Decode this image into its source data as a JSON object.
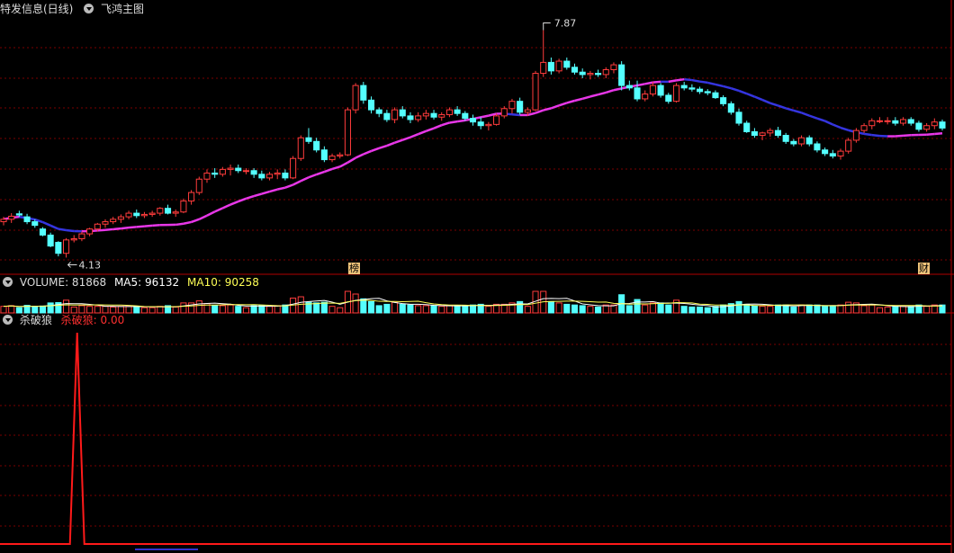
{
  "main_header": {
    "title": "特发信息(日线)",
    "indicator": "飞鸿主图"
  },
  "volume_header": {
    "volume": "VOLUME: 81868",
    "ma5": "MA5: 96132",
    "ma10": "MA10: 90258"
  },
  "osc_header": {
    "name": "杀破狼",
    "value": "杀破狼: 0.00"
  },
  "markers": {
    "high_label": "7.87",
    "low_label": "4.13",
    "tag_list": "榜",
    "tag_fin": "财"
  },
  "colors": {
    "up": "#ff3c3c",
    "down": "#54ffff",
    "ma_magenta": "#e837e8",
    "ma_blue": "#3535e0",
    "osc_line": "#ff1a1a",
    "grid": "#7a0000",
    "ma5_text": "#ffffff",
    "ma10_text": "#ffff55"
  },
  "chart_data": [
    {
      "type": "candlestick",
      "title": "特发信息(日线)",
      "y_range": [
        3.9,
        8.1
      ],
      "series": [
        {
          "name": "飞鸿主图",
          "values": []
        }
      ],
      "candles": [
        [
          4.72,
          4.8,
          4.66,
          4.76
        ],
        [
          4.76,
          4.86,
          4.7,
          4.81
        ],
        [
          4.85,
          4.9,
          4.8,
          4.83
        ],
        [
          4.8,
          4.85,
          4.68,
          4.72
        ],
        [
          4.72,
          4.76,
          4.62,
          4.66
        ],
        [
          4.6,
          4.63,
          4.48,
          4.5
        ],
        [
          4.5,
          4.54,
          4.3,
          4.32
        ],
        [
          4.38,
          4.4,
          4.15,
          4.2
        ],
        [
          4.2,
          4.45,
          4.13,
          4.42
        ],
        [
          4.42,
          4.5,
          4.38,
          4.44
        ],
        [
          4.44,
          4.56,
          4.4,
          4.52
        ],
        [
          4.52,
          4.62,
          4.48,
          4.6
        ],
        [
          4.6,
          4.7,
          4.56,
          4.68
        ],
        [
          4.68,
          4.76,
          4.62,
          4.72
        ],
        [
          4.72,
          4.8,
          4.68,
          4.76
        ],
        [
          4.76,
          4.84,
          4.7,
          4.8
        ],
        [
          4.8,
          4.9,
          4.76,
          4.86
        ],
        [
          4.86,
          4.92,
          4.78,
          4.82
        ],
        [
          4.82,
          4.88,
          4.78,
          4.84
        ],
        [
          4.84,
          4.9,
          4.8,
          4.86
        ],
        [
          4.86,
          4.96,
          4.82,
          4.94
        ],
        [
          4.94,
          5.0,
          4.84,
          4.86
        ],
        [
          4.86,
          4.92,
          4.8,
          4.88
        ],
        [
          4.88,
          5.1,
          4.86,
          5.06
        ],
        [
          5.06,
          5.24,
          5.0,
          5.2
        ],
        [
          5.2,
          5.46,
          5.16,
          5.42
        ],
        [
          5.42,
          5.58,
          5.36,
          5.52
        ],
        [
          5.52,
          5.6,
          5.44,
          5.5
        ],
        [
          5.5,
          5.62,
          5.46,
          5.58
        ],
        [
          5.58,
          5.66,
          5.48,
          5.6
        ],
        [
          5.6,
          5.66,
          5.52,
          5.56
        ],
        [
          5.56,
          5.6,
          5.5,
          5.56
        ],
        [
          5.56,
          5.6,
          5.44,
          5.5
        ],
        [
          5.5,
          5.56,
          5.4,
          5.44
        ],
        [
          5.44,
          5.54,
          5.4,
          5.5
        ],
        [
          5.5,
          5.58,
          5.42,
          5.52
        ],
        [
          5.52,
          5.58,
          5.4,
          5.44
        ],
        [
          5.44,
          5.8,
          5.42,
          5.76
        ],
        [
          5.76,
          6.14,
          5.72,
          6.1
        ],
        [
          6.1,
          6.26,
          6.0,
          6.04
        ],
        [
          6.04,
          6.1,
          5.86,
          5.9
        ],
        [
          5.9,
          5.96,
          5.7,
          5.74
        ],
        [
          5.74,
          5.84,
          5.7,
          5.8
        ],
        [
          5.8,
          5.86,
          5.76,
          5.82
        ],
        [
          5.82,
          6.6,
          5.8,
          6.56
        ],
        [
          6.56,
          7.0,
          6.5,
          6.96
        ],
        [
          6.96,
          7.02,
          6.66,
          6.72
        ],
        [
          6.72,
          6.78,
          6.5,
          6.56
        ],
        [
          6.56,
          6.6,
          6.44,
          6.5
        ],
        [
          6.5,
          6.56,
          6.36,
          6.4
        ],
        [
          6.4,
          6.6,
          6.34,
          6.56
        ],
        [
          6.56,
          6.62,
          6.42,
          6.46
        ],
        [
          6.46,
          6.52,
          6.34,
          6.4
        ],
        [
          6.4,
          6.52,
          6.36,
          6.46
        ],
        [
          6.46,
          6.56,
          6.4,
          6.5
        ],
        [
          6.5,
          6.56,
          6.4,
          6.44
        ],
        [
          6.44,
          6.52,
          6.38,
          6.48
        ],
        [
          6.48,
          6.6,
          6.44,
          6.56
        ],
        [
          6.56,
          6.62,
          6.46,
          6.5
        ],
        [
          6.5,
          6.54,
          6.38,
          6.42
        ],
        [
          6.42,
          6.48,
          6.3,
          6.36
        ],
        [
          6.36,
          6.44,
          6.24,
          6.3
        ],
        [
          6.3,
          6.36,
          6.22,
          6.32
        ],
        [
          6.32,
          6.5,
          6.3,
          6.46
        ],
        [
          6.46,
          6.62,
          6.42,
          6.58
        ],
        [
          6.58,
          6.74,
          6.5,
          6.7
        ],
        [
          6.7,
          6.76,
          6.48,
          6.52
        ],
        [
          6.52,
          6.6,
          6.46,
          6.56
        ],
        [
          6.56,
          7.2,
          6.54,
          7.16
        ],
        [
          7.16,
          7.87,
          7.1,
          7.34
        ],
        [
          7.34,
          7.42,
          7.14,
          7.2
        ],
        [
          7.2,
          7.4,
          7.16,
          7.36
        ],
        [
          7.36,
          7.42,
          7.22,
          7.26
        ],
        [
          7.26,
          7.32,
          7.14,
          7.18
        ],
        [
          7.18,
          7.24,
          7.08,
          7.14
        ],
        [
          7.14,
          7.2,
          7.06,
          7.16
        ],
        [
          7.16,
          7.22,
          7.1,
          7.14
        ],
        [
          7.14,
          7.26,
          7.08,
          7.22
        ],
        [
          7.22,
          7.34,
          7.16,
          7.3
        ],
        [
          7.3,
          7.36,
          6.88,
          6.96
        ],
        [
          6.96,
          7.04,
          6.88,
          6.92
        ],
        [
          6.92,
          7.04,
          6.7,
          6.74
        ],
        [
          6.74,
          6.88,
          6.7,
          6.82
        ],
        [
          6.82,
          7.02,
          6.78,
          6.96
        ],
        [
          6.96,
          7.0,
          6.76,
          6.8
        ],
        [
          6.8,
          6.84,
          6.66,
          6.7
        ],
        [
          6.7,
          7.0,
          6.68,
          6.96
        ],
        [
          6.96,
          7.02,
          6.88,
          6.92
        ],
        [
          6.92,
          6.98,
          6.86,
          6.9
        ],
        [
          6.9,
          6.94,
          6.82,
          6.86
        ],
        [
          6.86,
          6.9,
          6.8,
          6.84
        ],
        [
          6.84,
          6.88,
          6.74,
          6.76
        ],
        [
          6.76,
          6.8,
          6.62,
          6.66
        ],
        [
          6.66,
          6.7,
          6.48,
          6.52
        ],
        [
          6.52,
          6.58,
          6.3,
          6.34
        ],
        [
          6.34,
          6.38,
          6.18,
          6.2
        ],
        [
          6.2,
          6.26,
          6.1,
          6.14
        ],
        [
          6.14,
          6.2,
          6.06,
          6.18
        ],
        [
          6.18,
          6.26,
          6.12,
          6.22
        ],
        [
          6.22,
          6.28,
          6.1,
          6.14
        ],
        [
          6.14,
          6.18,
          6.0,
          6.04
        ],
        [
          6.04,
          6.08,
          5.96,
          6.0
        ],
        [
          6.0,
          6.14,
          5.96,
          6.1
        ],
        [
          6.1,
          6.14,
          5.96,
          6.0
        ],
        [
          6.0,
          6.04,
          5.86,
          5.9
        ],
        [
          5.9,
          5.94,
          5.8,
          5.84
        ],
        [
          5.84,
          5.9,
          5.76,
          5.8
        ],
        [
          5.8,
          5.92,
          5.74,
          5.88
        ],
        [
          5.88,
          6.1,
          5.84,
          6.06
        ],
        [
          6.06,
          6.26,
          6.02,
          6.22
        ],
        [
          6.22,
          6.34,
          6.18,
          6.3
        ],
        [
          6.3,
          6.42,
          6.24,
          6.38
        ],
        [
          6.38,
          6.44,
          6.34,
          6.38
        ],
        [
          6.38,
          6.44,
          6.32,
          6.38
        ],
        [
          6.38,
          6.44,
          6.3,
          6.34
        ],
        [
          6.34,
          6.44,
          6.3,
          6.4
        ],
        [
          6.4,
          6.44,
          6.3,
          6.34
        ],
        [
          6.34,
          6.38,
          6.2,
          6.24
        ],
        [
          6.24,
          6.34,
          6.2,
          6.3
        ],
        [
          6.3,
          6.42,
          6.24,
          6.36
        ],
        [
          6.36,
          6.4,
          6.22,
          6.26
        ]
      ],
      "high_annotation": 7.87,
      "low_annotation": 4.13
    },
    {
      "type": "bar",
      "title": "VOLUME",
      "series": [
        {
          "name": "VOLUME",
          "latest": 81868
        },
        {
          "name": "MA5",
          "latest": 96132
        },
        {
          "name": "MA10",
          "latest": 90258
        }
      ]
    },
    {
      "type": "line",
      "title": "杀破狼",
      "series": [
        {
          "name": "杀破狼",
          "latest": 0.0,
          "spike_index": 12
        }
      ]
    }
  ]
}
